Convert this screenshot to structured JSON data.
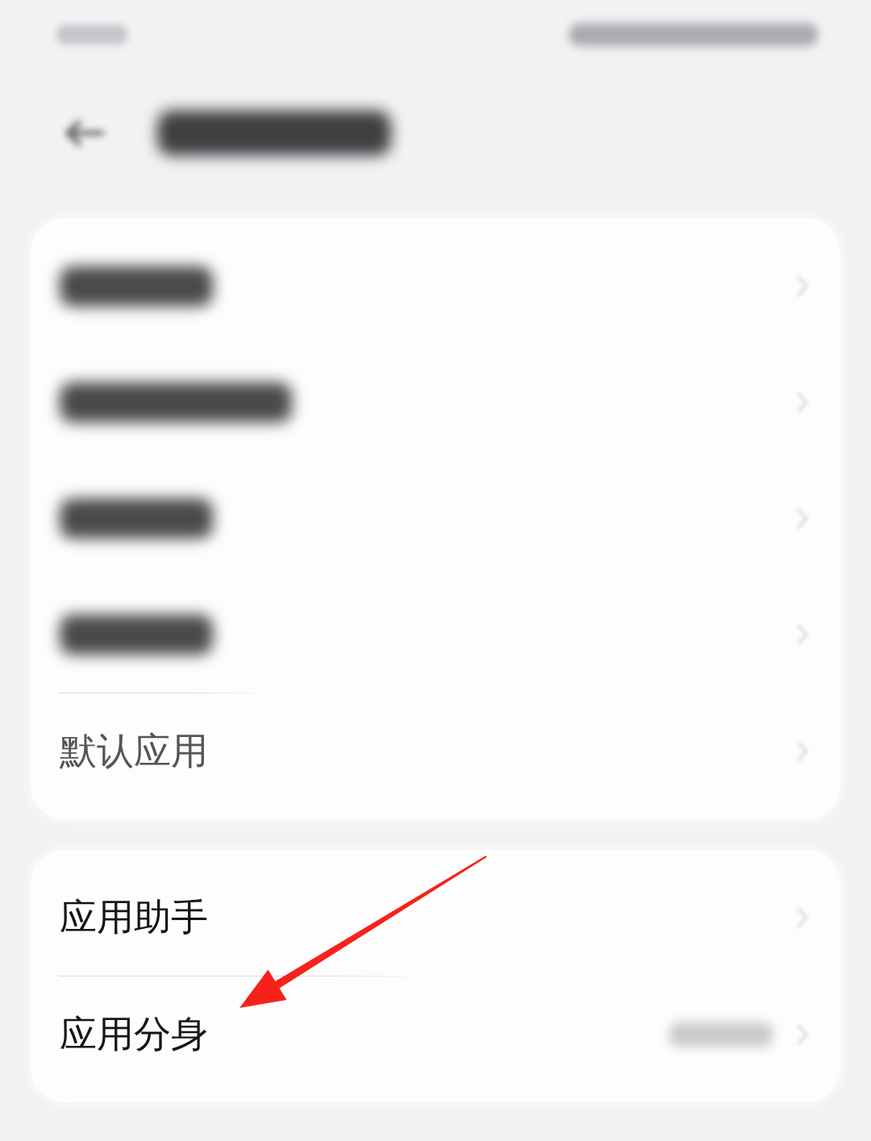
{
  "status_bar": {
    "blurred": true
  },
  "header": {
    "blurred": true
  },
  "cards": [
    {
      "rows": [
        {
          "kind": "blurred",
          "wide": false,
          "pointed": false,
          "value_blurred": false
        },
        {
          "kind": "blurred",
          "wide": true,
          "pointed": false,
          "value_blurred": false
        },
        {
          "kind": "blurred",
          "wide": false,
          "pointed": false,
          "value_blurred": false
        },
        {
          "kind": "blurred",
          "wide": false,
          "pointed": false,
          "value_blurred": false
        },
        {
          "kind": "text",
          "label": "默认应用",
          "dimmed": true,
          "pointed": false,
          "value_blurred": false
        }
      ]
    },
    {
      "rows": [
        {
          "kind": "text",
          "label": "应用助手",
          "dimmed": false,
          "pointed": false,
          "value_blurred": false
        },
        {
          "kind": "text",
          "label": "应用分身",
          "dimmed": false,
          "pointed": true,
          "value_blurred": true
        }
      ]
    }
  ]
}
